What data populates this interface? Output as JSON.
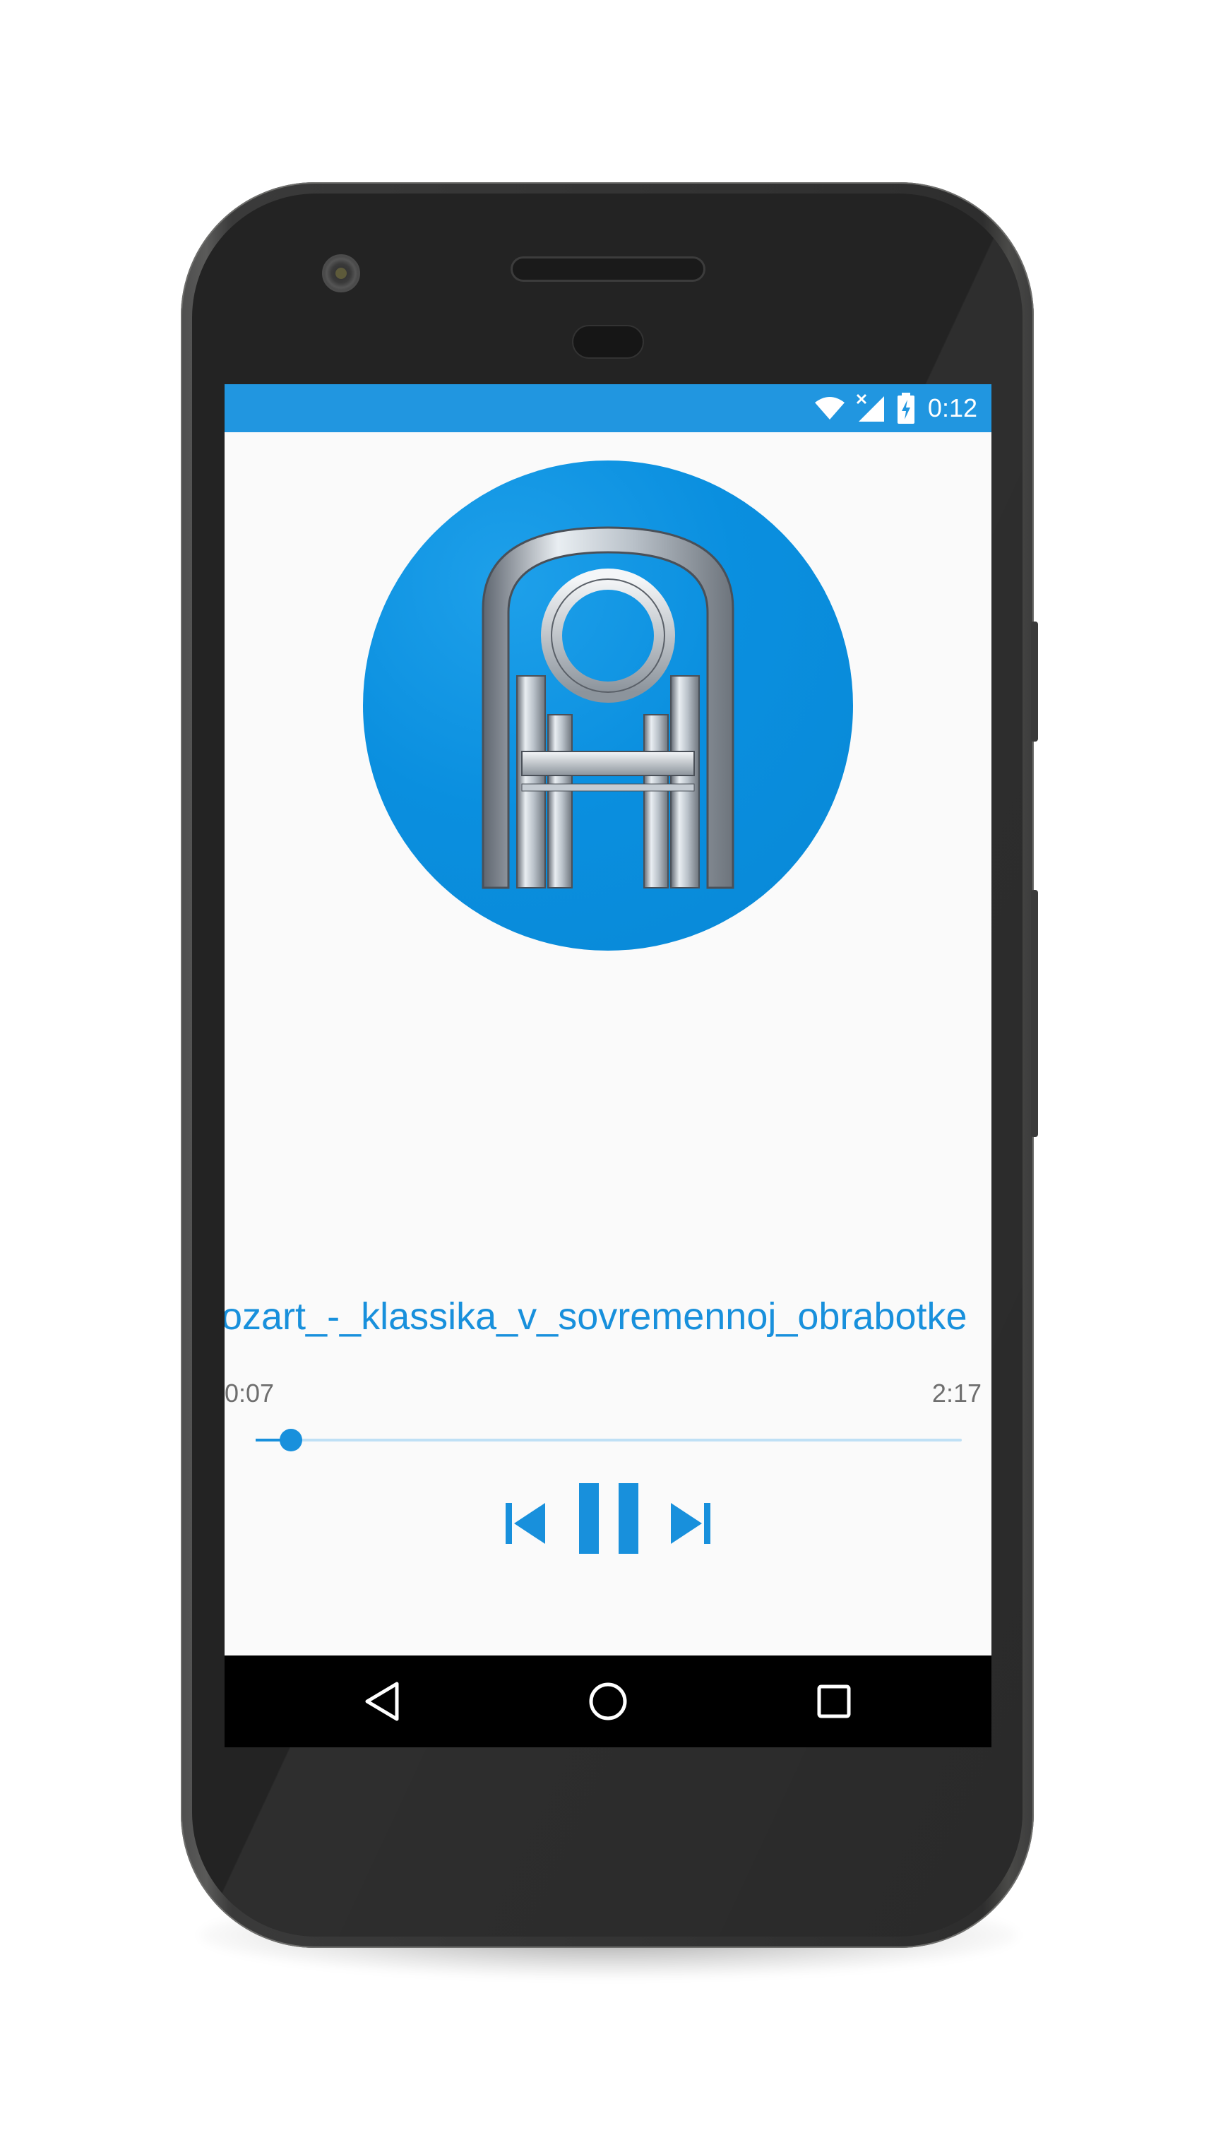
{
  "status_bar": {
    "time": "0:12",
    "icons": [
      "wifi-icon",
      "no-signal-icon",
      "battery-charging-icon"
    ],
    "color": "#2196e0"
  },
  "album_art": {
    "icon": "app-logo-arch-icon",
    "color": "#0a8fdf"
  },
  "player": {
    "track_title": "Mozart_-_klassika_v_sovremennoj_obrabotke",
    "elapsed": "0:07",
    "total": "2:17",
    "progress_fraction": 0.05,
    "state": "playing",
    "accent_color": "#1890dc"
  },
  "controls": {
    "previous": "skip-previous-icon",
    "play_pause": "pause-icon",
    "next": "skip-next-icon"
  },
  "nav_bar": {
    "back": "back-triangle-icon",
    "home": "home-circle-icon",
    "recents": "recents-square-icon"
  }
}
